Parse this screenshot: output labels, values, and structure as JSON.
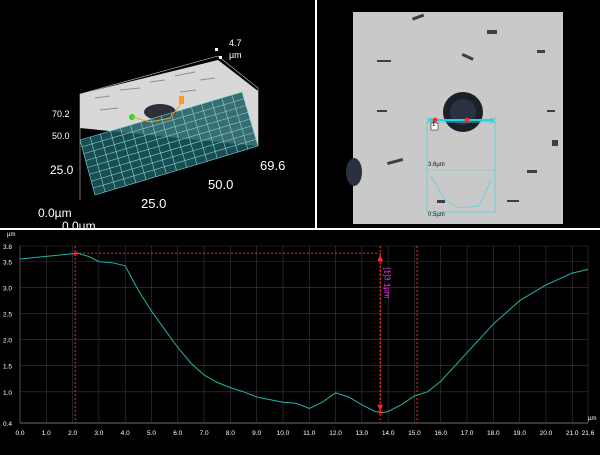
{
  "view3d": {
    "z_max": "4.7",
    "z_unit": "µm",
    "y_max": "70.2",
    "y_ticks": [
      "50.0",
      "25.0"
    ],
    "origin": "0.0µm",
    "origin_clipped": "0.0µm",
    "x_ticks": [
      "25.0",
      "50.0",
      "69.6"
    ]
  },
  "camera": {
    "marker_label": "1",
    "inset_top_label": "3.6µm",
    "inset_bottom_label": "0.5µm"
  },
  "profile": {
    "y_unit": "µm",
    "x_unit": "µm",
    "y_ticks": [
      "3.8",
      "3.5",
      "3.0",
      "2.5",
      "2.0",
      "1.5",
      "1.0",
      "0.4"
    ],
    "x_ticks": [
      "0.0",
      "1.0",
      "2.0",
      "3.0",
      "4.0",
      "5.0",
      "6.0",
      "7.0",
      "8.0",
      "9.0",
      "10.0",
      "11.0",
      "12.0",
      "13.0",
      "14.0",
      "15.0",
      "16.0",
      "17.0",
      "18.0",
      "19.0",
      "20.0",
      "21.0",
      "21.6"
    ],
    "measurement_label": "[1]3.1µm",
    "colors": {
      "profile_line": "#1fb5a8",
      "cursor": "#ff2a2a",
      "measure_text": "#ff33ff"
    }
  },
  "chart_data": {
    "type": "line",
    "title": "",
    "xlabel": "µm",
    "ylabel": "µm",
    "xlim": [
      0.0,
      21.6
    ],
    "ylim": [
      0.4,
      3.8
    ],
    "grid": true,
    "series": [
      {
        "x": [
          0.0,
          1.0,
          2.0,
          2.2,
          2.6,
          3.0,
          3.5,
          4.0,
          4.5,
          5.0,
          5.5,
          6.0,
          6.5,
          7.0,
          7.5,
          8.0,
          8.5,
          9.0,
          9.5,
          10.0,
          10.5,
          11.0,
          11.5,
          12.0,
          12.5,
          13.0,
          13.5,
          13.8,
          14.0,
          14.5,
          15.0,
          15.5,
          16.0,
          17.0,
          18.0,
          19.0,
          20.0,
          21.0,
          21.6
        ],
        "y": [
          3.55,
          3.6,
          3.65,
          3.66,
          3.6,
          3.5,
          3.48,
          3.42,
          2.95,
          2.55,
          2.2,
          1.85,
          1.55,
          1.32,
          1.18,
          1.08,
          1.0,
          0.9,
          0.85,
          0.8,
          0.78,
          0.68,
          0.8,
          0.98,
          0.9,
          0.75,
          0.62,
          0.6,
          0.62,
          0.75,
          0.92,
          1.0,
          1.2,
          1.75,
          2.3,
          2.75,
          3.05,
          3.28,
          3.35
        ]
      }
    ],
    "cursors_x": [
      2.1,
      13.7,
      15.1
    ],
    "measurement": {
      "x": 13.7,
      "from_y": 3.66,
      "to_y": 0.6,
      "label": "[1]3.1µm"
    }
  }
}
